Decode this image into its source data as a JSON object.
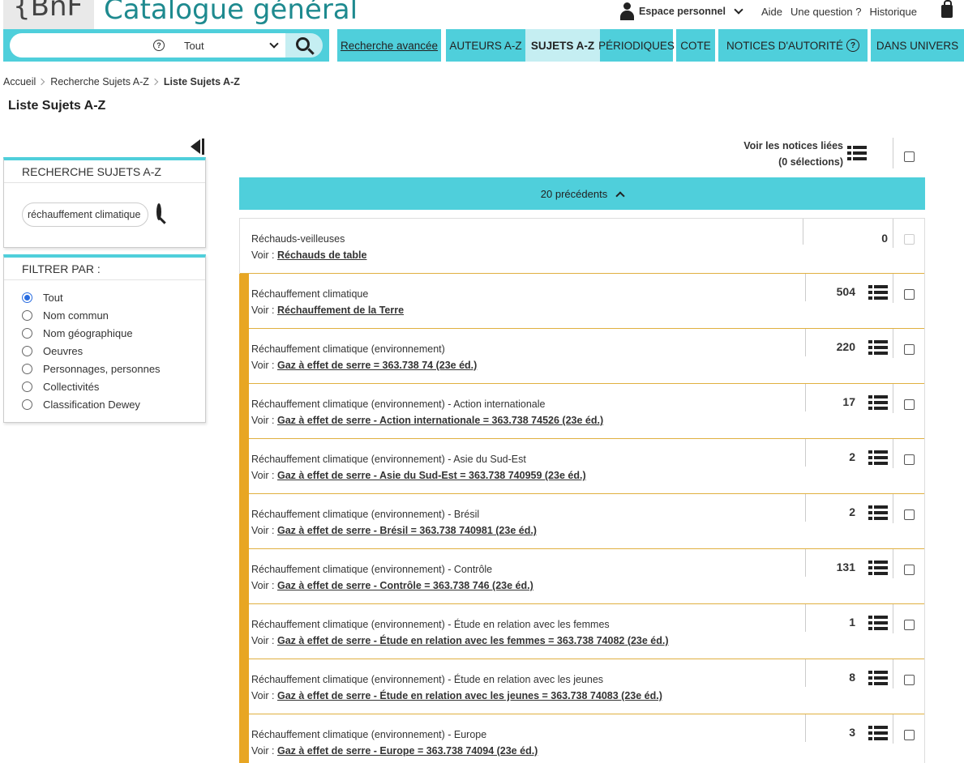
{
  "header": {
    "logo": "{BnF",
    "title": "Catalogue général",
    "espace_personnel": "Espace personnel",
    "links": [
      "Aide",
      "Une question ?",
      "Historique"
    ]
  },
  "search": {
    "placeholder": "",
    "scope": "Tout"
  },
  "nav": {
    "recherche_avancee": "Recherche avancée",
    "auteurs": "AUTEURS A-Z",
    "sujets": "SUJETS A-Z",
    "periodiques": "PÉRIODIQUES",
    "cote": "COTE",
    "notices_autorite": "NOTICES D'AUTORITÉ",
    "dans_univers": "DANS UNIVERS"
  },
  "breadcrumb": {
    "items": [
      "Accueil",
      "Recherche Sujets A-Z"
    ],
    "current": "Liste Sujets A-Z"
  },
  "page_title": "Liste Sujets A-Z",
  "sidebar": {
    "search_panel_title": "RECHERCHE SUJETS A-Z",
    "search_term": "réchauffement climatique",
    "filter_title": "FILTRER PAR :",
    "filters": [
      {
        "label": "Tout",
        "checked": true
      },
      {
        "label": "Nom commun",
        "checked": false
      },
      {
        "label": "Nom géographique",
        "checked": false
      },
      {
        "label": "Oeuvres",
        "checked": false
      },
      {
        "label": "Personnages, personnes",
        "checked": false
      },
      {
        "label": "Collectivités",
        "checked": false
      },
      {
        "label": "Classification Dewey",
        "checked": false
      }
    ]
  },
  "results": {
    "voir_notices_line1": "Voir les notices liées",
    "voir_notices_line2": "(0 sélections)",
    "previous": "20 précédents",
    "voir_prefix": "Voir :",
    "rows": [
      {
        "label": "Réchauds-veilleuses",
        "voir": "Réchauds de table",
        "count": "0",
        "highlight": false
      },
      {
        "label": "Réchauffement climatique",
        "voir": "Réchauffement de la Terre",
        "count": "504",
        "highlight": true
      },
      {
        "label": "Réchauffement climatique (environnement)",
        "voir": "Gaz à effet de serre = 363.738 74 (23e éd.)",
        "count": "220",
        "highlight": true
      },
      {
        "label": "Réchauffement climatique (environnement) - Action internationale",
        "voir": "Gaz à effet de serre - Action internationale = 363.738 74526 (23e éd.)",
        "count": "17",
        "highlight": true
      },
      {
        "label": "Réchauffement climatique (environnement) - Asie du Sud-Est",
        "voir": "Gaz à effet de serre - Asie du Sud-Est = 363.738 740959 (23e éd.)",
        "count": "2",
        "highlight": true
      },
      {
        "label": "Réchauffement climatique (environnement) - Brésil",
        "voir": "Gaz à effet de serre - Brésil = 363.738 740981 (23e éd.)",
        "count": "2",
        "highlight": true
      },
      {
        "label": "Réchauffement climatique (environnement) - Contrôle",
        "voir": "Gaz à effet de serre - Contrôle = 363.738 746 (23e éd.)",
        "count": "131",
        "highlight": true
      },
      {
        "label": "Réchauffement climatique (environnement) - Étude en relation avec les femmes",
        "voir": "Gaz à effet de serre - Étude en relation avec les femmes = 363.738 74082 (23e éd.)",
        "count": "1",
        "highlight": true
      },
      {
        "label": "Réchauffement climatique (environnement) - Étude en relation avec les jeunes",
        "voir": "Gaz à effet de serre - Étude en relation avec les jeunes = 363.738 74083 (23e éd.)",
        "count": "8",
        "highlight": true
      },
      {
        "label": "Réchauffement climatique (environnement) - Europe",
        "voir": "Gaz à effet de serre - Europe = 363.738 74094 (23e éd.)",
        "count": "3",
        "highlight": true
      }
    ]
  },
  "colors": {
    "accent": "#4fcfdb",
    "accent_light": "#c5eef2",
    "title": "#1e8a8f",
    "highlight": "#e8a623"
  },
  "icons": {
    "person": "person-icon",
    "bag": "bag-icon",
    "search": "search-icon",
    "list": "list-icon",
    "collapse": "collapse-panel-icon",
    "help": "help-icon"
  }
}
